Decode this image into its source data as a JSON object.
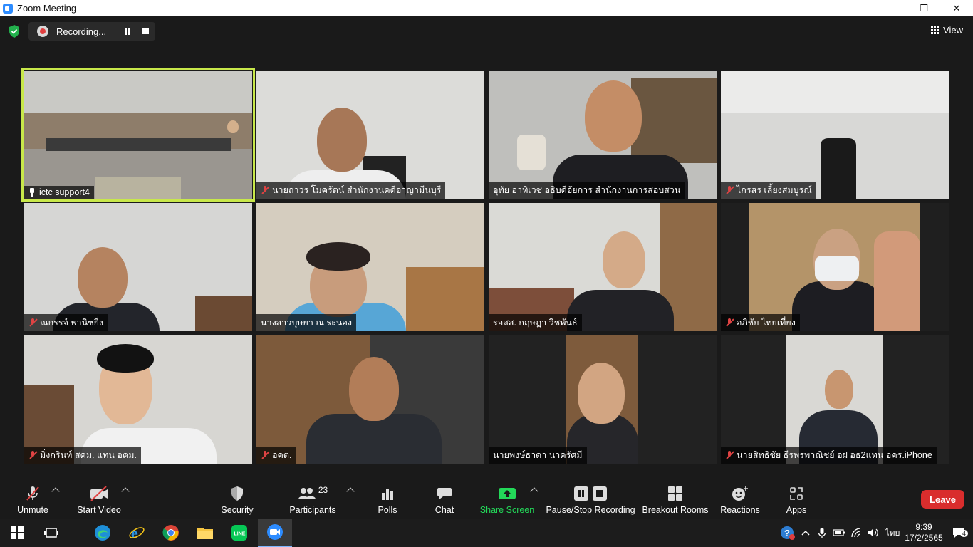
{
  "window": {
    "title": "Zoom Meeting",
    "controls": [
      "—",
      "❐",
      "✕"
    ]
  },
  "meeting": {
    "recording_label": "Recording...",
    "view_label": "View"
  },
  "participants": [
    {
      "name": "ictc support4",
      "muted": false,
      "pinned": true,
      "active": true
    },
    {
      "name": "นายถาวร โมครัตน์ สำนักงานคดีอาญามีนบุรี",
      "muted": true
    },
    {
      "name": "อุทัย อาทิเวช อธิบดีอัยการ สำนักงานการสอบสวน",
      "muted": false
    },
    {
      "name": "ไกรสร เลี้ยงสมบูรณ์",
      "muted": true
    },
    {
      "name": "ณกรรจ์ พานิชยิ่ง",
      "muted": true
    },
    {
      "name": "นางสาวบุษยา ณ ระนอง",
      "muted": false
    },
    {
      "name": "รอสส. กฤษฎา วิชพันธ์",
      "muted": false
    },
    {
      "name": "อภิชัย ไทยเที่ยง",
      "muted": true
    },
    {
      "name": "มิ่งกรินท์ สคม. แทน อคม.",
      "muted": true
    },
    {
      "name": "อคต.",
      "muted": true
    },
    {
      "name": "นายพงษ์ธาดา นาครัศมี",
      "muted": false
    },
    {
      "name": "นายสิทธิชัย ธีรพรพาณิชย์ อฝ อธ2แทน อคร.iPhone",
      "muted": true
    }
  ],
  "toolbar": {
    "unmute": "Unmute",
    "start_video": "Start Video",
    "security": "Security",
    "participants": "Participants",
    "participants_count": "23",
    "polls": "Polls",
    "chat": "Chat",
    "share_screen": "Share Screen",
    "pause_stop_recording": "Pause/Stop Recording",
    "breakout_rooms": "Breakout Rooms",
    "reactions": "Reactions",
    "apps": "Apps",
    "leave": "Leave"
  },
  "colors": {
    "active_speaker_border": "#c8e84a",
    "share_green": "#23d959",
    "leave_red": "#d92d2d",
    "muted_red": "#e04343"
  },
  "taskbar": {
    "apps": [
      "start-icon",
      "task-view-icon",
      "edge-icon",
      "ie-icon",
      "chrome-icon",
      "file-explorer-icon",
      "line-icon",
      "zoom-icon"
    ],
    "language": "ไทย",
    "time": "9:39",
    "date": "17/2/2565",
    "notification_count": "4"
  }
}
